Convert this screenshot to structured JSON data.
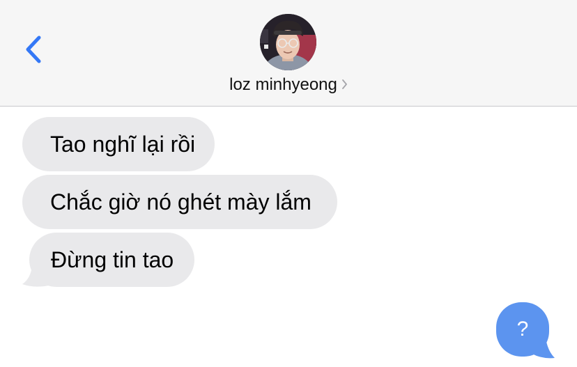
{
  "header": {
    "contact_name": "loz minhyeong",
    "icons": [
      "chevron-left-icon",
      "avatar",
      "chevron-right-icon"
    ]
  },
  "messages": [
    {
      "sender": "contact",
      "text": "Tao nghĩ lại rồi"
    },
    {
      "sender": "contact",
      "text": "Chắc giờ nó ghét mày lắm"
    },
    {
      "sender": "contact",
      "text": "Đừng tin tao"
    }
  ],
  "help_bubble": {
    "label": "?"
  },
  "colors": {
    "accent_blue": "#3478f6",
    "incoming_bubble": "#e9e9eb",
    "help_bubble": "#5c94ef",
    "header_bg": "#f6f6f6"
  }
}
